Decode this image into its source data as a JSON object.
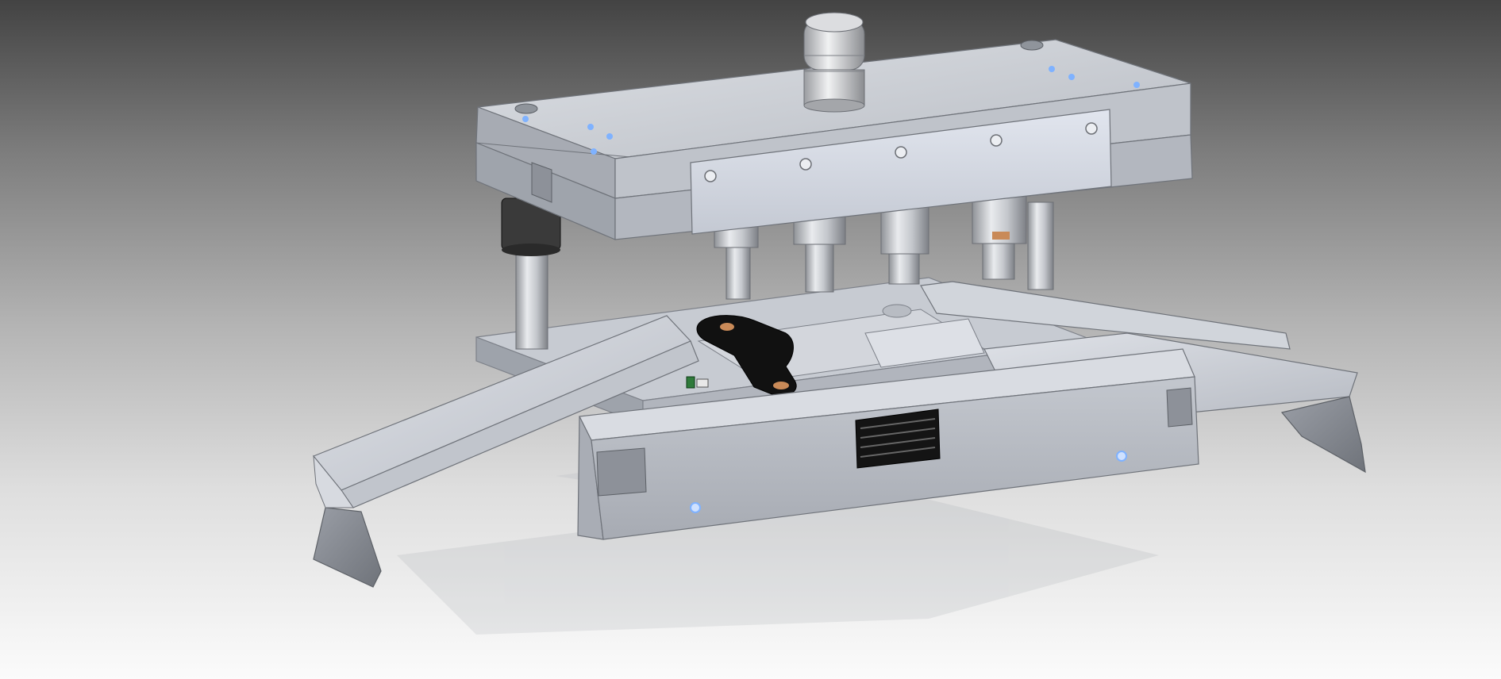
{
  "viewport": {
    "background_top": "#434343",
    "background_bottom": "#fbfbfb"
  },
  "model": {
    "plate_color": "#c9cdd4",
    "plate_top_color": "#d6d9df",
    "plate_side_color": "#9ea3ab",
    "guide_plate_color": "#d7dce5",
    "pin_color": "#c8cbd0",
    "bushing_color": "#333333",
    "blank_color": "#111111",
    "copper_color": "#c98a58",
    "marker_color": "#7fb2ff",
    "shadow_color": "#ffffff"
  }
}
